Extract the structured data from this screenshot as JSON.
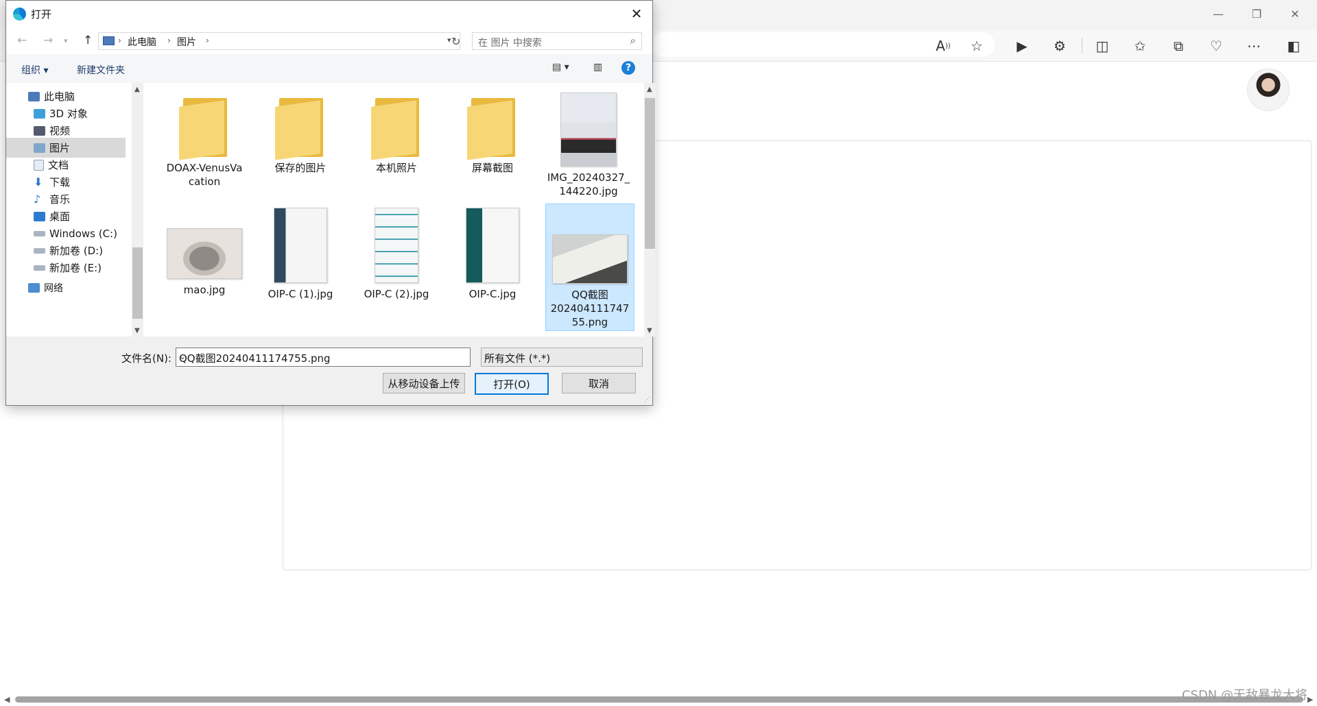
{
  "browser": {
    "window_controls": [
      "—",
      "❐",
      "✕"
    ],
    "toolbar_icons": [
      "read-aloud-icon",
      "favorite-star-icon",
      "play-icon",
      "extensions-icon",
      "split-screen-icon",
      "favorites-icon",
      "collections-icon",
      "browser-essentials-icon",
      "more-icon",
      "sidebar-icon"
    ]
  },
  "dialog": {
    "title": "打开",
    "breadcrumb": [
      "此电脑",
      "图片"
    ],
    "search_placeholder": "在 图片 中搜索",
    "commands": {
      "organize": "组织 ▾",
      "new_folder": "新建文件夹"
    },
    "help": "?",
    "tree": [
      {
        "label": "此电脑",
        "icon": "this-pc-icon",
        "selected": false
      },
      {
        "label": "3D 对象",
        "icon": "3d-objects-icon",
        "selected": false
      },
      {
        "label": "视频",
        "icon": "videos-icon",
        "selected": false
      },
      {
        "label": "图片",
        "icon": "pictures-icon",
        "selected": true
      },
      {
        "label": "文档",
        "icon": "documents-icon",
        "selected": false
      },
      {
        "label": "下载",
        "icon": "downloads-icon",
        "selected": false
      },
      {
        "label": "音乐",
        "icon": "music-icon",
        "selected": false
      },
      {
        "label": "桌面",
        "icon": "desktop-icon",
        "selected": false
      },
      {
        "label": "Windows (C:)",
        "icon": "drive-c-icon",
        "selected": false
      },
      {
        "label": "新加卷 (D:)",
        "icon": "drive-d-icon",
        "selected": false
      },
      {
        "label": "新加卷 (E:)",
        "icon": "drive-e-icon",
        "selected": false
      },
      {
        "label": "网络",
        "icon": "network-icon",
        "selected": false
      }
    ],
    "files": [
      {
        "name_line1": "DOAX-VenusVa",
        "name_line2": "cation",
        "name_line3": "",
        "kind": "folder"
      },
      {
        "name_line1": "保存的图片",
        "name_line2": "",
        "name_line3": "",
        "kind": "folder"
      },
      {
        "name_line1": "本机照片",
        "name_line2": "",
        "name_line3": "",
        "kind": "folder"
      },
      {
        "name_line1": "屏幕截图",
        "name_line2": "",
        "name_line3": "",
        "kind": "folder"
      },
      {
        "name_line1": "IMG_20240327_",
        "name_line2": "144220.jpg",
        "name_line3": "",
        "kind": "photo-document"
      },
      {
        "name_line1": "mao.jpg",
        "name_line2": "",
        "name_line3": "",
        "kind": "photo-cat"
      },
      {
        "name_line1": "OIP-C (1).jpg",
        "name_line2": "",
        "name_line3": "",
        "kind": "photo-resume"
      },
      {
        "name_line1": "OIP-C (2).jpg",
        "name_line2": "",
        "name_line3": "",
        "kind": "photo-resume"
      },
      {
        "name_line1": "OIP-C.jpg",
        "name_line2": "",
        "name_line3": "",
        "kind": "photo-resume"
      },
      {
        "name_line1": "QQ截图",
        "name_line2": "202404111747",
        "name_line3": "55.png",
        "kind": "photo-book",
        "selected": true
      }
    ],
    "filename_label": "文件名(N):",
    "filename_value": "QQ截图20240411174755.png",
    "filetype_value": "所有文件 (*.*)",
    "buttons": {
      "upload": "从移动设备上传",
      "open": "打开(O)",
      "cancel": "取消"
    }
  },
  "watermark": "CSDN @无敌暴龙大将"
}
